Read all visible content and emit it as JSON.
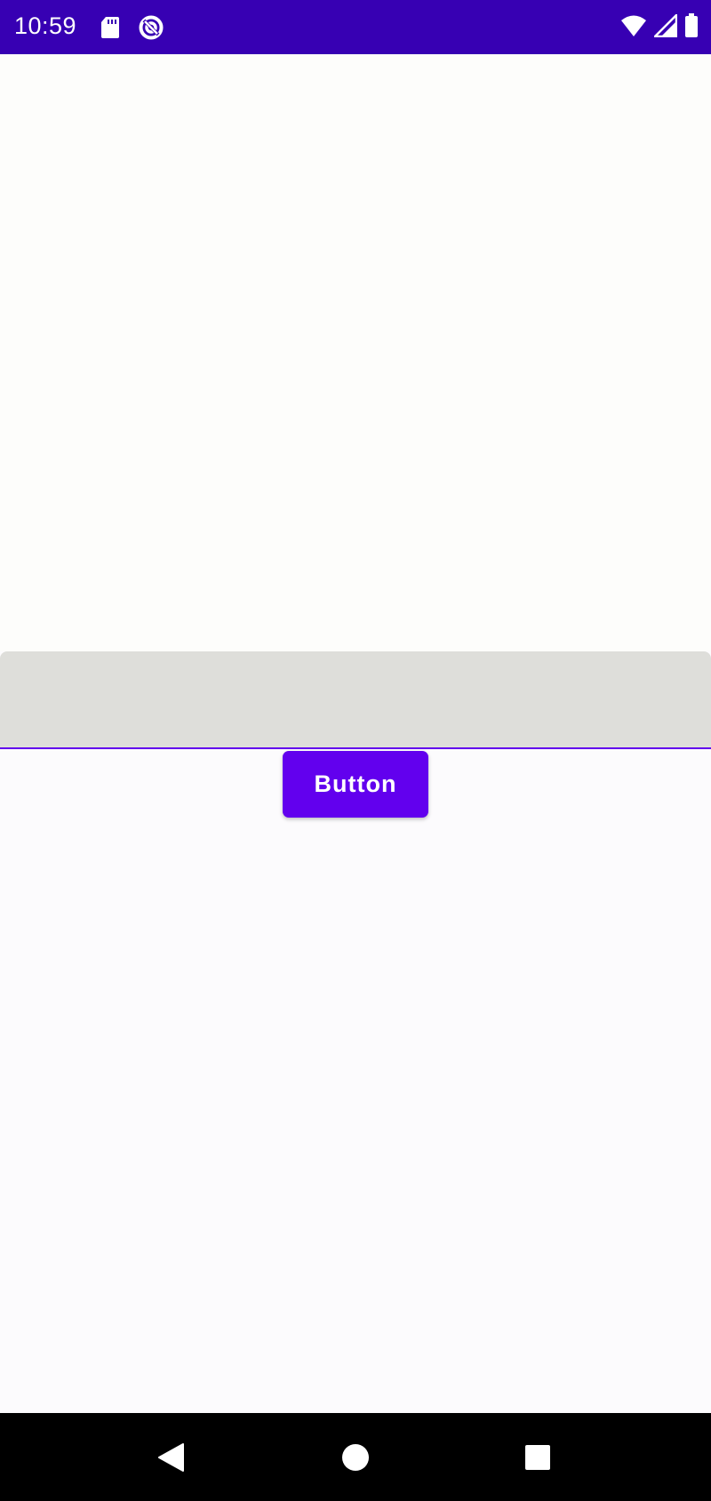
{
  "status_bar": {
    "time": "10:59",
    "left_icons": [
      "sd-card-icon",
      "data-saver-icon"
    ],
    "right_icons": [
      "wifi-icon",
      "cell-signal-icon",
      "battery-icon"
    ],
    "background_color": "#3700b3"
  },
  "text_field": {
    "value": "",
    "placeholder": "",
    "underline_color": "#6200ee",
    "background_color": "#dededa"
  },
  "main_button": {
    "label": "Button",
    "color": "#6200ee"
  },
  "nav_bar": {
    "buttons": [
      "back-icon",
      "home-icon",
      "recents-icon"
    ]
  }
}
